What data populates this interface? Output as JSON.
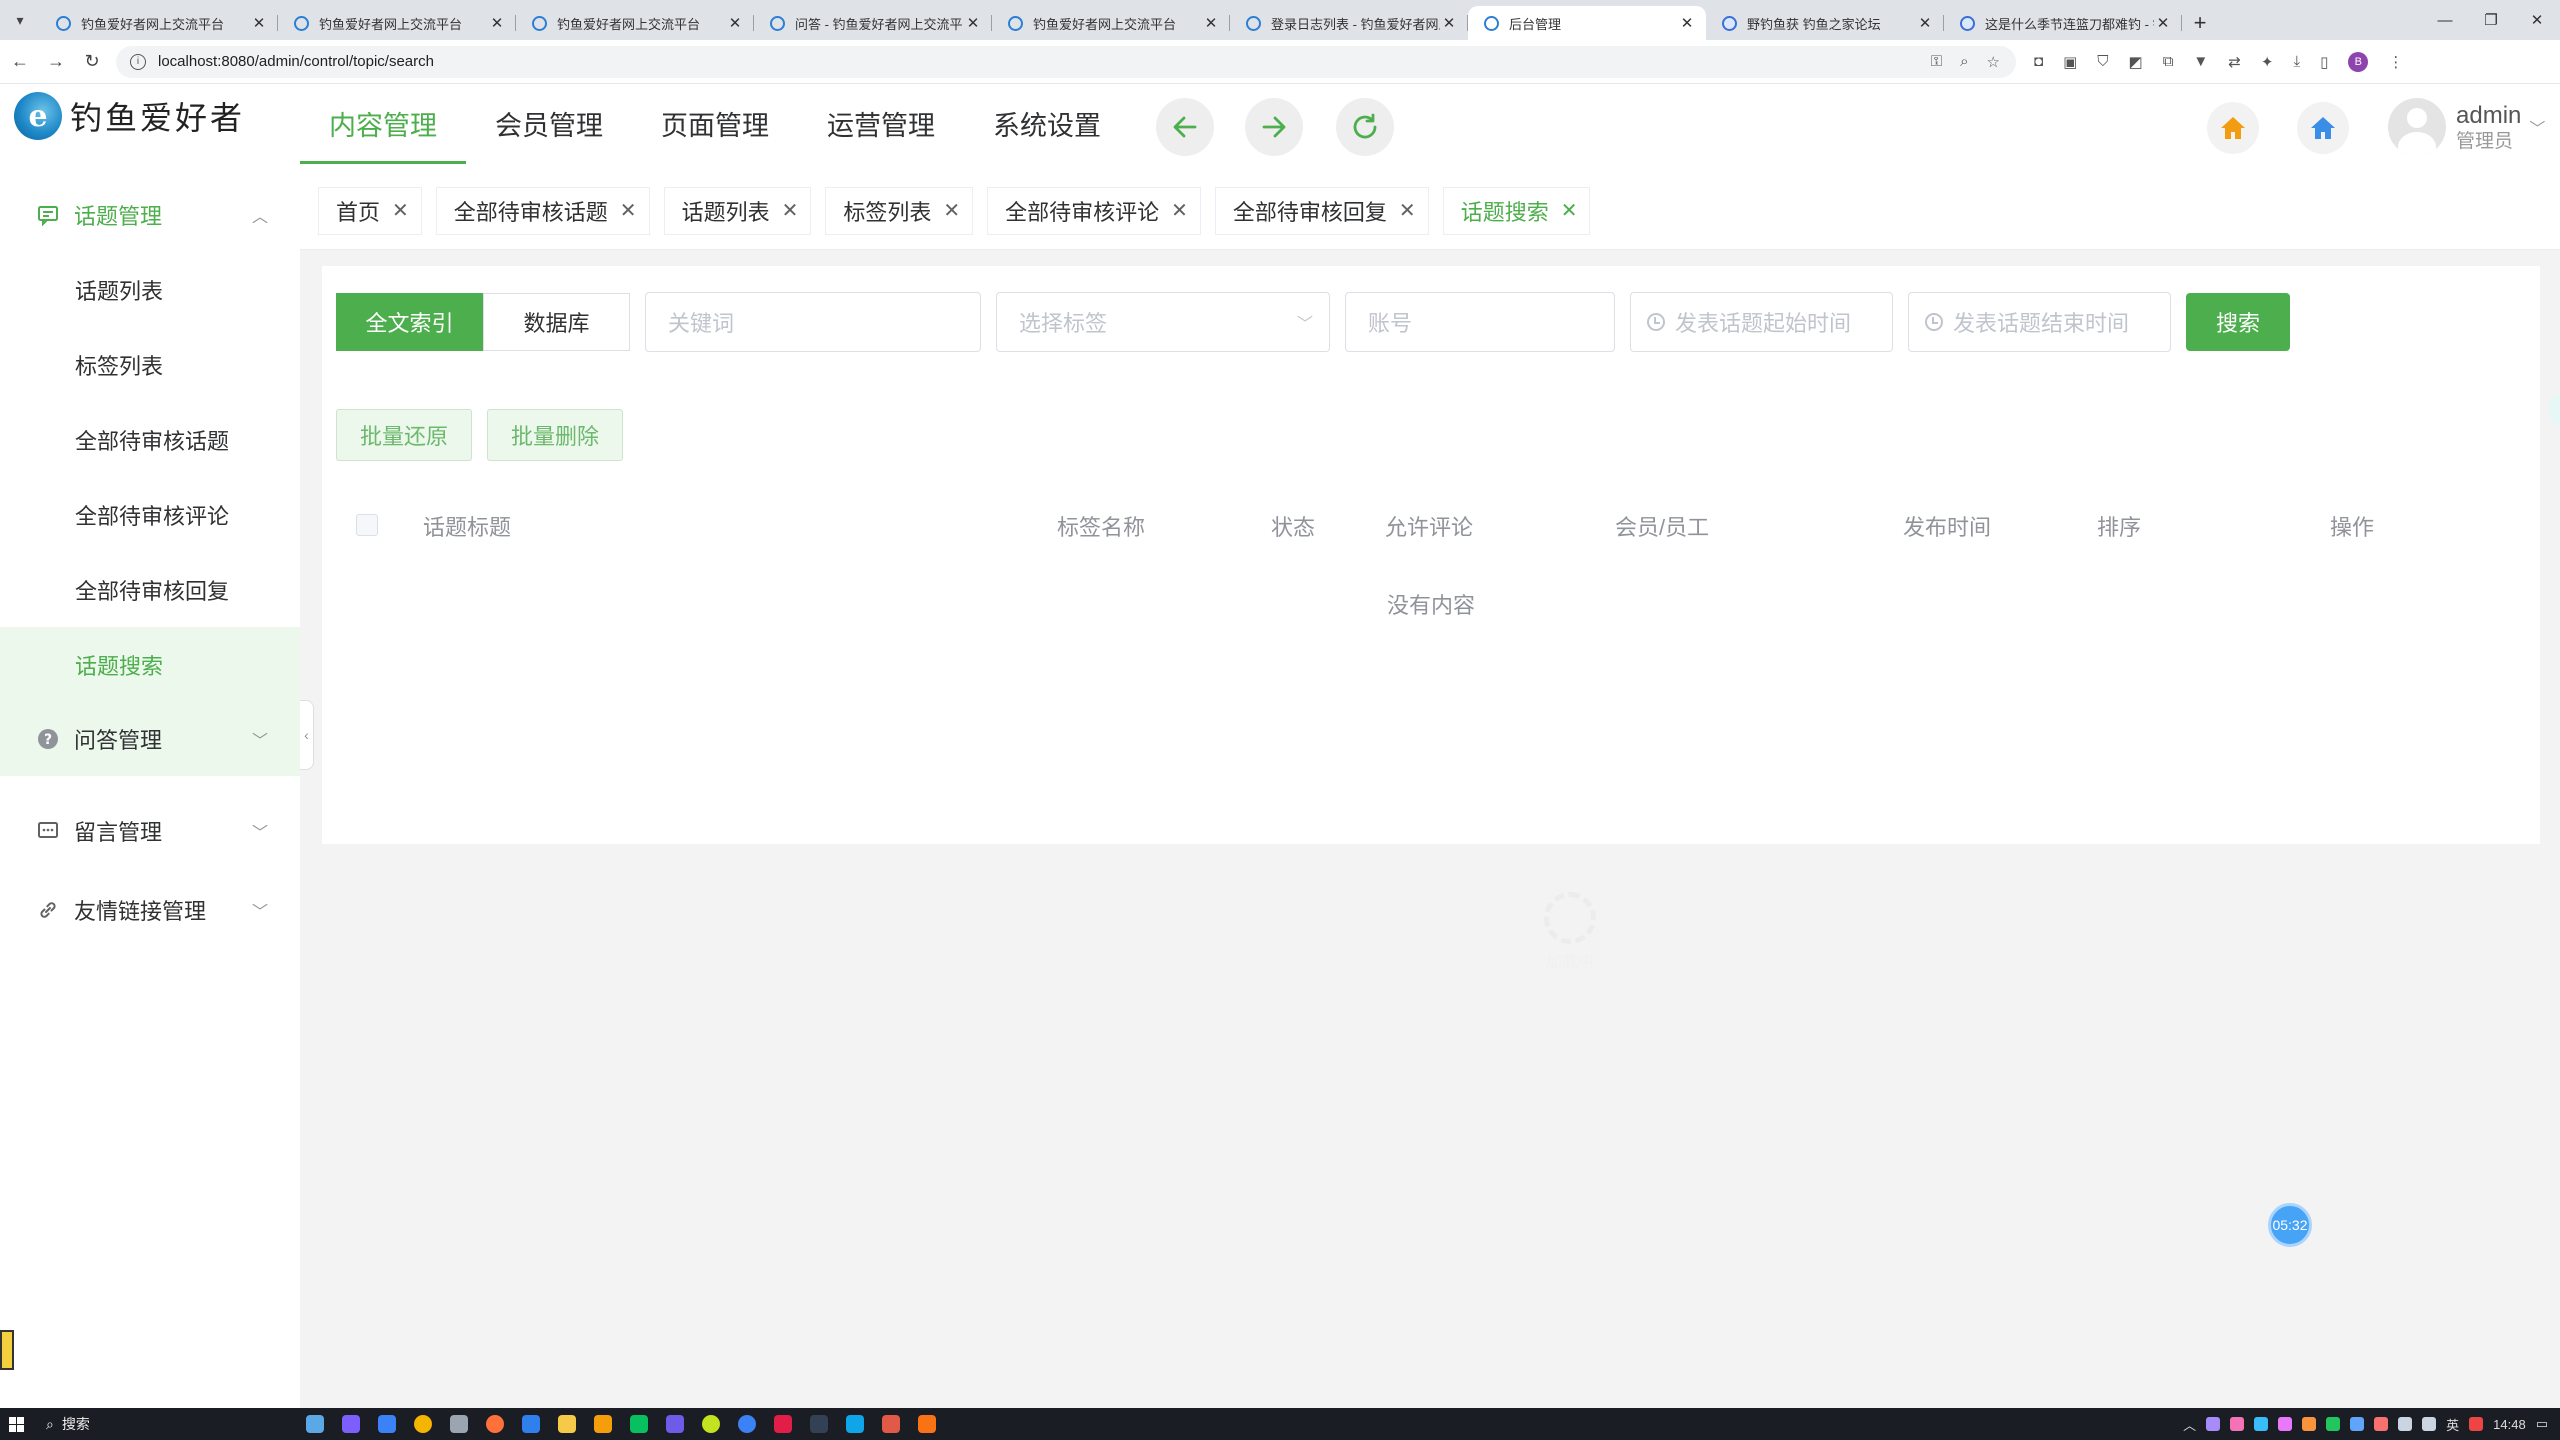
{
  "browser": {
    "tabs": [
      {
        "title": "钓鱼爱好者网上交流平台",
        "active": false
      },
      {
        "title": "钓鱼爱好者网上交流平台",
        "active": false
      },
      {
        "title": "钓鱼爱好者网上交流平台",
        "active": false
      },
      {
        "title": "问答 - 钓鱼爱好者网上交流平台",
        "active": false
      },
      {
        "title": "钓鱼爱好者网上交流平台",
        "active": false
      },
      {
        "title": "登录日志列表 - 钓鱼爱好者网上",
        "active": false
      },
      {
        "title": "后台管理",
        "active": true
      },
      {
        "title": "野钓鱼获 钓鱼之家论坛",
        "active": false
      },
      {
        "title": "这是什么季节连篮刀都难钓 - 钓",
        "active": false
      }
    ],
    "url": "localhost:8080/admin/control/topic/search"
  },
  "header": {
    "logo_mark": "e",
    "logo_text": "钓鱼爱好者",
    "nav": [
      "内容管理",
      "会员管理",
      "页面管理",
      "运营管理",
      "系统设置"
    ],
    "active_nav": "内容管理",
    "user": {
      "name": "admin",
      "role": "管理员"
    },
    "colors": {
      "accent": "#4cae4c",
      "home_orange": "#f39c12",
      "home_blue": "#3a8ee6"
    }
  },
  "sidebar": {
    "groups": [
      {
        "label": "话题管理",
        "icon": "message-square-icon",
        "open": true,
        "items": [
          "话题列表",
          "标签列表",
          "全部待审核话题",
          "全部待审核评论",
          "全部待审核回复",
          "话题搜索"
        ],
        "active_item": "话题搜索"
      },
      {
        "label": "问答管理",
        "icon": "question-circle-icon",
        "open": false
      },
      {
        "label": "留言管理",
        "icon": "message-dots-icon",
        "open": false
      },
      {
        "label": "友情链接管理",
        "icon": "link-icon",
        "open": false
      }
    ]
  },
  "tags": [
    {
      "label": "首页",
      "active": false
    },
    {
      "label": "全部待审核话题",
      "active": false
    },
    {
      "label": "话题列表",
      "active": false
    },
    {
      "label": "标签列表",
      "active": false
    },
    {
      "label": "全部待审核评论",
      "active": false
    },
    {
      "label": "全部待审核回复",
      "active": false
    },
    {
      "label": "话题搜索",
      "active": true
    }
  ],
  "search": {
    "modes": [
      "全文索引",
      "数据库"
    ],
    "active_mode": "全文索引",
    "keyword_placeholder": "关键词",
    "tag_placeholder": "选择标签",
    "account_placeholder": "账号",
    "start_placeholder": "发表话题起始时间",
    "end_placeholder": "发表话题结束时间",
    "search_button": "搜索"
  },
  "batch": {
    "restore": "批量还原",
    "delete": "批量删除"
  },
  "table": {
    "columns": [
      "话题标题",
      "标签名称",
      "状态",
      "允许评论",
      "会员/员工",
      "发布时间",
      "排序",
      "操作"
    ],
    "rows": [],
    "empty_text": "没有内容"
  },
  "loading_text": "加载中",
  "timer": "05:32",
  "taskbar": {
    "search_label": "搜索",
    "clock": "14:48",
    "ime": "英"
  }
}
